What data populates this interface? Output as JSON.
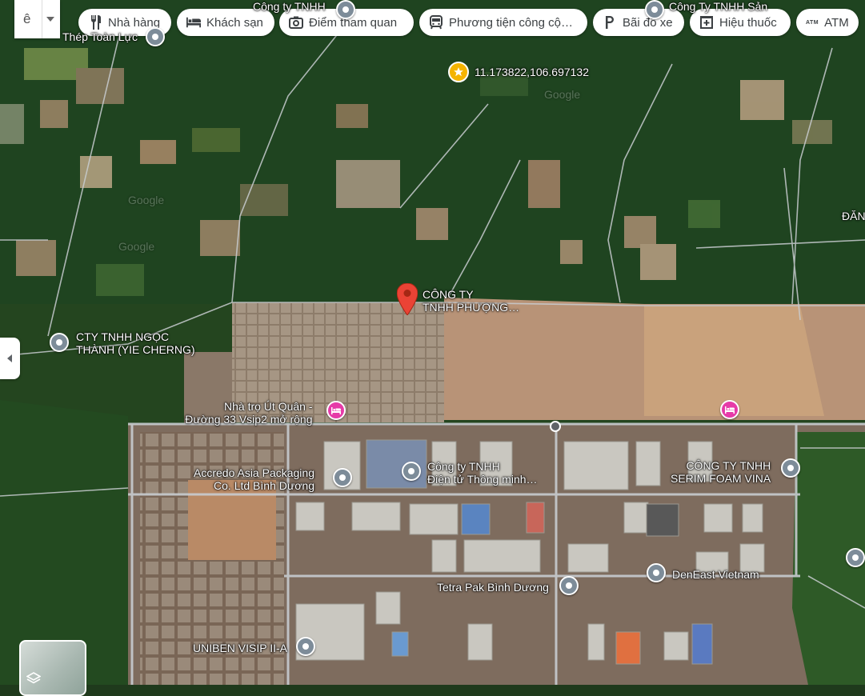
{
  "filters": [
    {
      "label": "Nhà hàng",
      "icon": "restaurant-icon"
    },
    {
      "label": "Khách sạn",
      "icon": "hotel-icon"
    },
    {
      "label": "Điểm tham quan",
      "icon": "camera-icon"
    },
    {
      "label": "Phương tiện công cộ…",
      "icon": "transit-icon"
    },
    {
      "label": "Bãi đỗ xe",
      "icon": "parking-icon"
    },
    {
      "label": "Hiệu thuốc",
      "icon": "pharmacy-icon"
    },
    {
      "label": "ATM",
      "icon": "atm-icon",
      "badge": "ATM"
    }
  ],
  "menu": {
    "logo": "ê"
  },
  "coordinate_label": "11.173822,106.697132",
  "selected_place": {
    "line1": "CÔNG TY",
    "line2": "TNHH PHƯỢNG…"
  },
  "places": [
    {
      "name": "Công ty TNHH",
      "kind": "grey"
    },
    {
      "name": "Công Ty TNHH Sản",
      "kind": "grey"
    },
    {
      "name": "Thép Toàn Lực",
      "kind": "grey"
    },
    {
      "name": "CTY TNHH NGỌC",
      "name2": "THÀNH (YIE CHERNG)",
      "kind": "grey"
    },
    {
      "name": "Nhà trọ Út Quân -",
      "name2": "Đường 33 Vsip2 mở rộng",
      "kind": "pink"
    },
    {
      "name": "",
      "kind": "pink"
    },
    {
      "name": "Accredo Asia Packaging",
      "name2": "Co. Ltd Bình Dương",
      "kind": "grey"
    },
    {
      "name": "Công ty TNHH",
      "name2": "Điện tử Thông minh…",
      "kind": "grey"
    },
    {
      "name": "CÔNG TY TNHH",
      "name2": "SERIM FOAM VINA",
      "kind": "grey"
    },
    {
      "name": "DenEast Vietnam",
      "kind": "grey"
    },
    {
      "name": "Tetra Pak Bình Dương",
      "kind": "grey"
    },
    {
      "name": "UNIBEN VISIP II-A",
      "kind": "grey"
    },
    {
      "name": "ĐĂN",
      "kind": "none"
    }
  ],
  "watermarks": [
    "Google",
    "Google",
    "Google"
  ],
  "colors": {
    "pin_grey": "#7d8c99",
    "pin_pink": "#e63ba8",
    "selected_pin": "#ea4335",
    "star": "#f4b400",
    "road": "#c8ccd0"
  }
}
